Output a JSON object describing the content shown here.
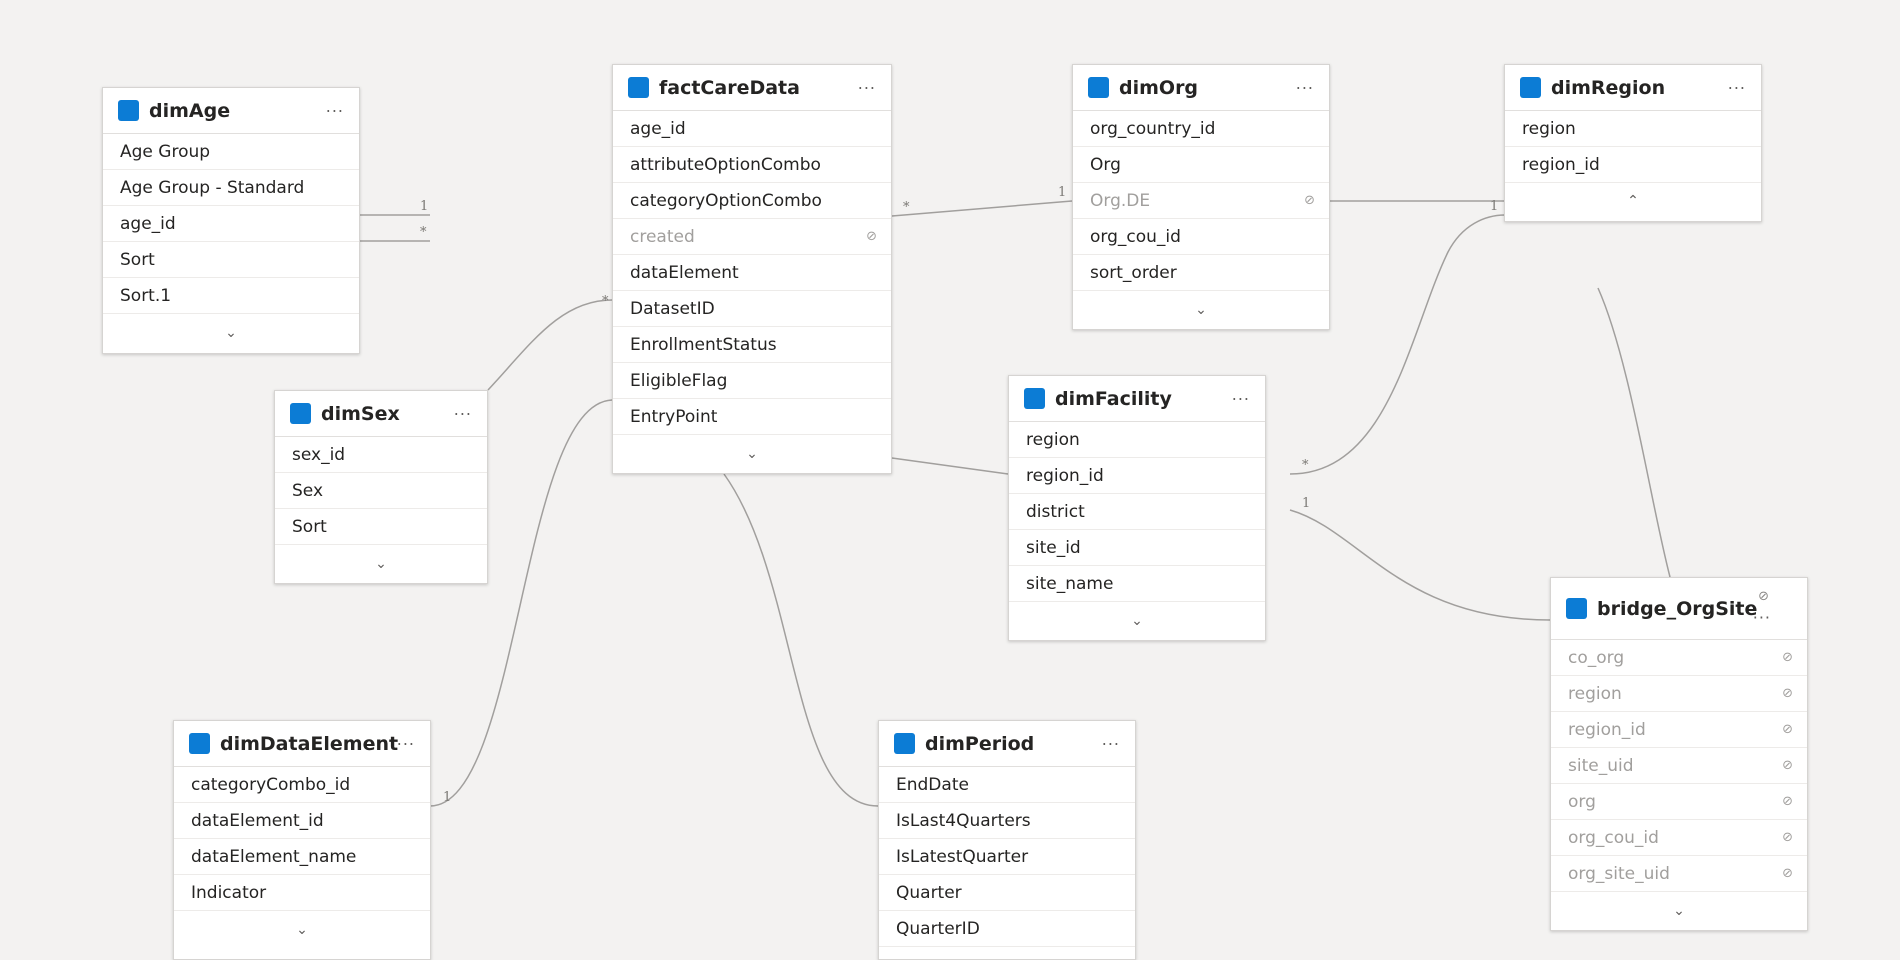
{
  "tables": {
    "dimAge": {
      "title": "dimAge",
      "more": "···",
      "fields": [
        "Age Group",
        "Age Group - Standard",
        "age_id",
        "Sort",
        "Sort.1"
      ],
      "footer": "⌄"
    },
    "dimSex": {
      "title": "dimSex",
      "more": "···",
      "fields": [
        "sex_id",
        "Sex",
        "Sort"
      ],
      "footer": "⌄"
    },
    "factCareData": {
      "title": "factCareData",
      "more": "···",
      "fields": [
        "age_id",
        "attributeOptionCombo",
        "categoryOptionCombo",
        "created",
        "dataElement",
        "DatasetID",
        "EnrollmentStatus",
        "EligibleFlag",
        "EntryPoint"
      ],
      "hidden_fields": [
        "created"
      ],
      "footer": "⌄"
    },
    "dimOrg": {
      "title": "dimOrg",
      "more": "···",
      "fields": [
        "org_country_id",
        "Org",
        "Org.DE",
        "org_cou_id",
        "sort_order"
      ],
      "hidden_fields": [
        "Org.DE"
      ],
      "footer": "⌄"
    },
    "dimRegion": {
      "title": "dimRegion",
      "more": "···",
      "fields": [
        "region",
        "region_id"
      ],
      "footer": "⌃"
    },
    "dimFacility": {
      "title": "dimFacility",
      "more": "···",
      "fields": [
        "region",
        "region_id",
        "district",
        "site_id",
        "site_name"
      ],
      "footer": "⌄"
    },
    "bridge_OrgSite": {
      "title": "bridge_OrgSite",
      "more": "···",
      "hidden_marker": "⊘",
      "fields": [
        "co_org",
        "region",
        "region_id",
        "site_uid",
        "org",
        "org_cou_id",
        "org_site_uid"
      ],
      "hidden_fields": [
        "co_org",
        "region",
        "region_id",
        "site_uid",
        "org",
        "org_cou_id",
        "org_site_uid"
      ],
      "footer": "⌄"
    },
    "dimDataElement": {
      "title": "dimDataElement",
      "more": "···",
      "fields": [
        "categoryCombo_id",
        "dataElement_id",
        "dataElement_name",
        "Indicator"
      ],
      "footer": "⌄"
    },
    "dimPeriod": {
      "title": "dimPeriod",
      "more": "···",
      "fields": [
        "EndDate",
        "IsLast4Quarters",
        "IsLatestQuarter",
        "Quarter",
        "QuarterID"
      ],
      "footer": ""
    }
  },
  "relationships": [
    {
      "name": "dimAge-factCareData-one",
      "label": "1"
    },
    {
      "name": "dimAge-factCareData-many",
      "label": "*"
    },
    {
      "name": "dimSex-factCareData",
      "label": "*"
    },
    {
      "name": "factCareData-dimOrg",
      "from_label": "*",
      "to_label": "1"
    },
    {
      "name": "dimOrg-dimRegion",
      "label": "1"
    },
    {
      "name": "dimFacility-dimRegion",
      "label": "*"
    },
    {
      "name": "dimFacility-bridge",
      "label": "1"
    },
    {
      "name": "dimDataElement-factCareData",
      "label": "1"
    }
  ],
  "colors": {
    "canvas": "#f3f2f1",
    "table_icon": "#0c7cd5",
    "connector": "#a19f9d",
    "hidden_text": "#a19f9d"
  },
  "icons": {
    "table": "table-icon",
    "more": "more-options-icon",
    "hidden": "hidden-eye-icon",
    "expand": "chevron-down-icon",
    "collapse": "chevron-up-icon"
  }
}
